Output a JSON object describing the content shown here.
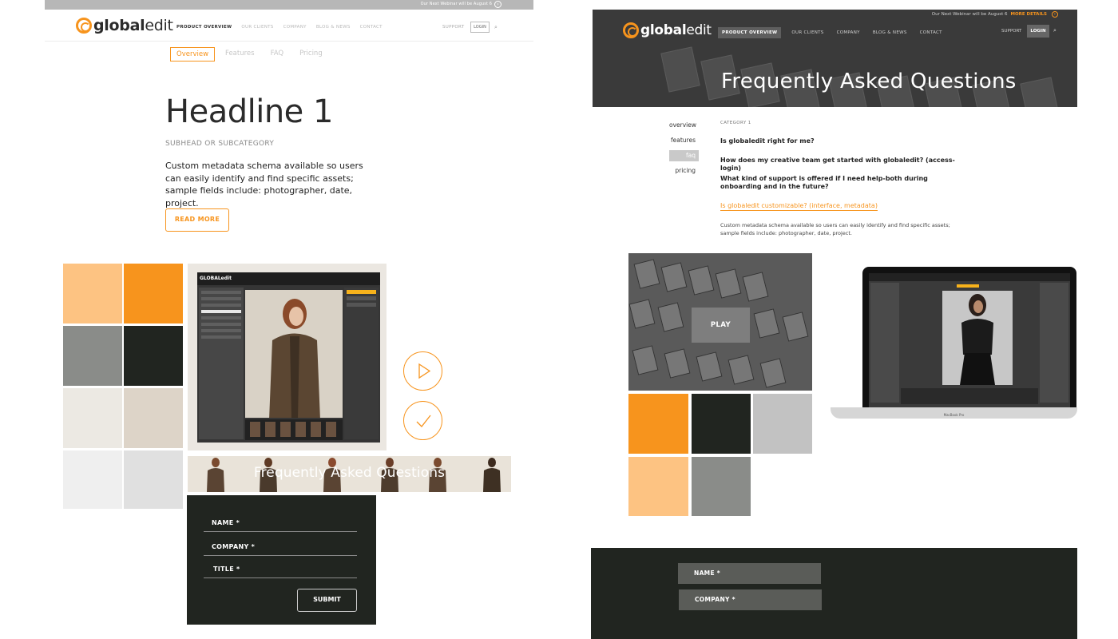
{
  "left": {
    "topbar_text": "Our Next Webinar will be August 6",
    "logo_prefix": "global",
    "logo_suffix": "edit",
    "nav": [
      "PRODUCT OVERVIEW",
      "OUR CLIENTS",
      "COMPANY",
      "BLOG & NEWS",
      "CONTACT"
    ],
    "support": "SUPPORT",
    "login": "LOGIN",
    "subnav": [
      "Overview",
      "Features",
      "FAQ",
      "Pricing"
    ],
    "headline": "Headline 1",
    "subhead": "SUBHEAD OR SUBCATEGORY",
    "body": "Custom metadata schema available so users can easily identify and find specific assets; sample fields include: photographer, date, project.",
    "read_more": "READ MORE",
    "app_logo": "GLOBALedit",
    "faq_strip_title": "Frequently Asked Questions",
    "form": {
      "name": "NAME *",
      "company": "COMPANY *",
      "title": "TITLE *",
      "submit": "SUBMIT"
    }
  },
  "swatches": {
    "orange_light": "#fdc382",
    "orange": "#f7941d",
    "gray": "#8a8c89",
    "dark": "#212520",
    "cream_light": "#ece9e3",
    "cream": "#ddd4c8",
    "silver": "#c2c2c2",
    "off_white": "#efefef",
    "light_gray": "#e0e0e0"
  },
  "right": {
    "topline": "Our Next Webinar will be August 6",
    "topline_link": "MORE DETAILS",
    "logo_prefix": "global",
    "logo_suffix": "edit",
    "nav": [
      "PRODUCT OVERVIEW",
      "OUR CLIENTS",
      "COMPANY",
      "BLOG & NEWS",
      "CONTACT"
    ],
    "support": "SUPPORT",
    "login": "LOGIN",
    "hero_title": "Frequently Asked Questions",
    "side_nav": [
      "overview",
      "features",
      "faq",
      "pricing"
    ],
    "category": "CATEGORY 1",
    "questions": [
      "Is globaledit right for me?",
      "How does my creative team get started with globaledit? (access-login)",
      "What kind of support is offered if I need help-both during onboarding and in the future?"
    ],
    "active_question": "Is globaledit customizable? (interface, metadata)",
    "answer": "Custom metadata schema available so users can easily identify and find specific assets; sample fields include: photographer, date, project.",
    "play": "PLAY",
    "laptop_label": "MacBook Pro",
    "form": {
      "name": "NAME *",
      "company": "COMPANY *"
    }
  }
}
